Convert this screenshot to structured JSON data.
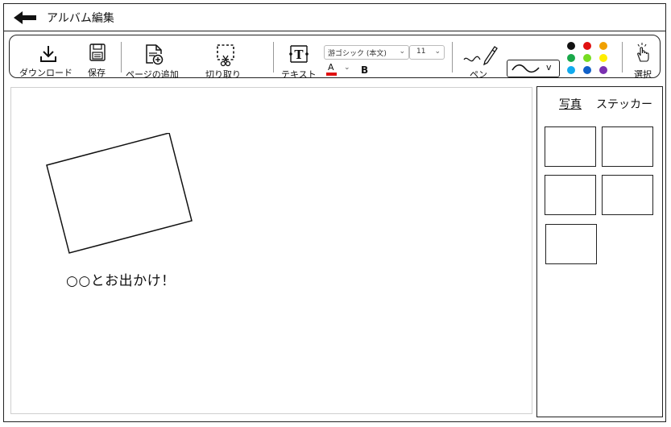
{
  "app": {
    "title": "アルバム編集"
  },
  "toolbar": {
    "download_label": "ダウンロード",
    "save_label": "保存",
    "add_page_label": "ページの追加",
    "cut_label": "切り取り",
    "text_label": "テキスト",
    "font_family": "游ゴシック (本文)",
    "font_size": "11",
    "font_color_letter": "A",
    "bold_letter": "B",
    "pen_label": "ペン",
    "stroke_value": "v",
    "select_label": "選択",
    "palette": [
      "#111111",
      "#e01010",
      "#f0a000",
      "#1aa84a",
      "#77dd22",
      "#ffee00",
      "#11aaee",
      "#1060c8",
      "#7a30b0"
    ],
    "font_color_underline": "#e01010"
  },
  "canvas": {
    "caption": "○○とお出かけ！"
  },
  "sidebar": {
    "tabs": [
      {
        "label": "写真",
        "active": true
      },
      {
        "label": "ステッカー",
        "active": false
      }
    ]
  }
}
